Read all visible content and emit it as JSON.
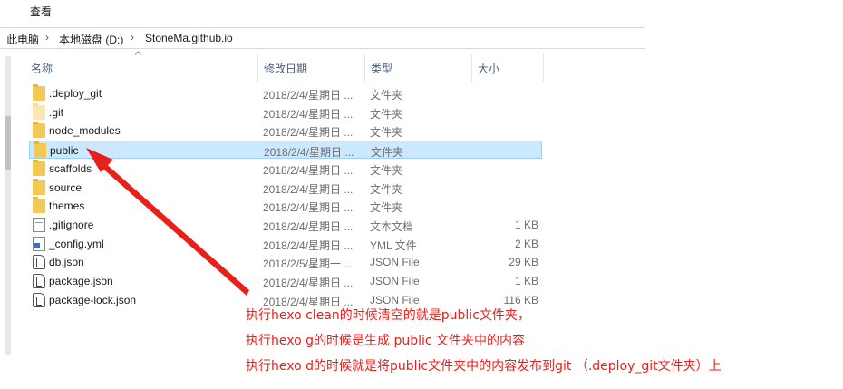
{
  "ribbon": {
    "view_tab": "查看"
  },
  "breadcrumb": [
    "此电脑",
    "本地磁盘 (D:)",
    "StoneMa.github.io"
  ],
  "columns": {
    "name": "名称",
    "date": "修改日期",
    "type": "类型",
    "size": "大小"
  },
  "files": [
    {
      "name": ".deploy_git",
      "date": "2018/2/4/星期日 ...",
      "type": "文件夹",
      "size": "",
      "icon": "folder-icon"
    },
    {
      "name": ".git",
      "date": "2018/2/4/星期日 ...",
      "type": "文件夹",
      "size": "",
      "icon": "folder-icon-faded"
    },
    {
      "name": "node_modules",
      "date": "2018/2/4/星期日 ...",
      "type": "文件夹",
      "size": "",
      "icon": "folder-icon"
    },
    {
      "name": "public",
      "date": "2018/2/4/星期日 ...",
      "type": "文件夹",
      "size": "",
      "icon": "folder-icon",
      "selected": true
    },
    {
      "name": "scaffolds",
      "date": "2018/2/4/星期日 ...",
      "type": "文件夹",
      "size": "",
      "icon": "folder-icon"
    },
    {
      "name": "source",
      "date": "2018/2/4/星期日 ...",
      "type": "文件夹",
      "size": "",
      "icon": "folder-icon"
    },
    {
      "name": "themes",
      "date": "2018/2/4/星期日 ...",
      "type": "文件夹",
      "size": "",
      "icon": "folder-icon"
    },
    {
      "name": ".gitignore",
      "date": "2018/2/4/星期日 ...",
      "type": "文本文档",
      "size": "1 KB",
      "icon": "text-document-icon"
    },
    {
      "name": "_config.yml",
      "date": "2018/2/4/星期日 ...",
      "type": "YML 文件",
      "size": "2 KB",
      "icon": "yml-file-icon"
    },
    {
      "name": "db.json",
      "date": "2018/2/5/星期一 ...",
      "type": "JSON File",
      "size": "29 KB",
      "icon": "json-file-icon"
    },
    {
      "name": "package.json",
      "date": "2018/2/4/星期日 ...",
      "type": "JSON File",
      "size": "1 KB",
      "icon": "json-file-icon"
    },
    {
      "name": "package-lock.json",
      "date": "2018/2/4/星期日 ...",
      "type": "JSON File",
      "size": "116 KB",
      "icon": "json-file-icon"
    }
  ],
  "annotations": [
    "执行hexo clean的时候清空的就是public文件夹，",
    "执行hexo g的时候是生成 public 文件夹中的内容",
    "执行hexo d的时候就是将public文件夹中的内容发布到git （.deploy_git文件夹）上"
  ],
  "colors": {
    "annotation": "#e8201c",
    "selection": "#cce8ff",
    "folder": "#f2c955"
  }
}
